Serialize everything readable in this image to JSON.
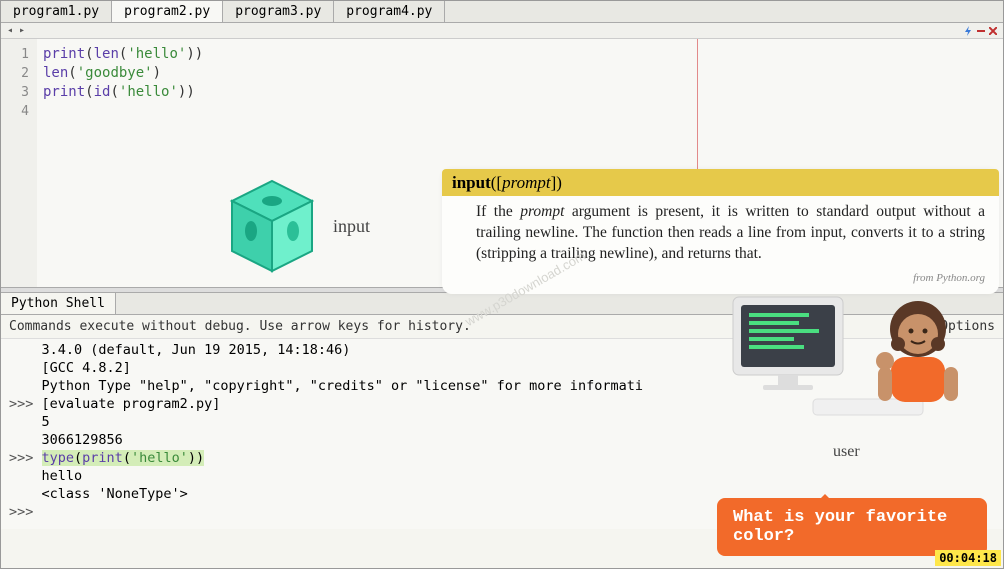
{
  "tabs": {
    "items": [
      "program1.py",
      "program2.py",
      "program3.py",
      "program4.py"
    ],
    "active_index": 1
  },
  "nav": {
    "left_glyph": "◂ ▸"
  },
  "editor": {
    "gutter": [
      "1",
      "2",
      "3",
      "4"
    ],
    "lines": [
      {
        "fn1": "print",
        "p1": "(",
        "fn2": "len",
        "p2": "(",
        "str": "'hello'",
        "p3": ")",
        "p4": ")"
      },
      {
        "fn1": "len",
        "p1": "(",
        "str": "'goodbye'",
        "p2": ")"
      },
      {
        "fn1": "print",
        "p1": "(",
        "fn2": "id",
        "p2": "(",
        "str": "'hello'",
        "p3": ")",
        "p4": ")"
      }
    ]
  },
  "cube": {
    "label": "input"
  },
  "doc": {
    "sig_name": "input",
    "sig_open": "(",
    "sig_br_open": "[",
    "sig_arg": "prompt",
    "sig_br_close": "]",
    "sig_close": ")",
    "body_pre": "If the ",
    "body_em": "prompt",
    "body_post": " argument is present, it is written to standard output without a trailing newline. The function then reads a line from input, converts it to a string (stripping a trailing newline), and returns that.",
    "source": "from Python.org"
  },
  "watermark": "www.p30download.com",
  "shell": {
    "tab": "Python Shell",
    "info": "Commands execute without debug.  Use arrow keys for history.",
    "options": "Options",
    "lines": {
      "l0": "    3.4.0 (default, Jun 19 2015, 14:18:46)",
      "l1": "    [GCC 4.8.2]",
      "l2": "    Python Type \"help\", \"copyright\", \"credits\" or \"license\" for more informati",
      "p3": ">>> ",
      "l3": "[evaluate program2.py]",
      "l4": "    5",
      "l5": "    3066129856",
      "p6": ">>> ",
      "l6_fn1": "type",
      "l6_p1": "(",
      "l6_fn2": "print",
      "l6_p2": "(",
      "l6_str": "'hello'",
      "l6_p3": ")",
      "l6_p4": ")",
      "l7": "    hello",
      "l8": "    <class 'NoneType'>",
      "p9": ">>> "
    }
  },
  "user_graphic": {
    "label": "user"
  },
  "speech": {
    "text": "What is your favorite color?"
  },
  "timestamp": "00:04:18"
}
